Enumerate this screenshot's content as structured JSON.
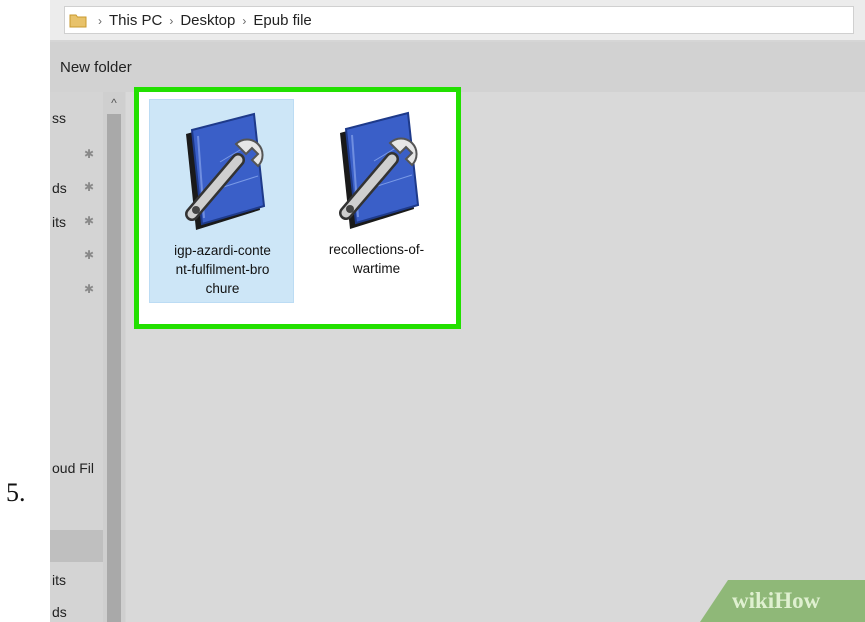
{
  "step_number": "5.",
  "address_bar": {
    "crumbs": [
      "This PC",
      "Desktop",
      "Epub file"
    ],
    "separator": "›"
  },
  "toolbar": {
    "new_folder_label": "New folder"
  },
  "nav_pane": {
    "items": [
      {
        "label": "ss",
        "pinned": false
      },
      {
        "label": "",
        "pinned": true
      },
      {
        "label": "ds",
        "pinned": true
      },
      {
        "label": "its",
        "pinned": true
      },
      {
        "label": "",
        "pinned": true
      },
      {
        "label": "",
        "pinned": true
      },
      {
        "label": "oud Fil",
        "pinned": false
      },
      {
        "label": "its",
        "pinned": false
      },
      {
        "label": "ds",
        "pinned": false
      }
    ],
    "pin_glyph": "✱",
    "scroll_up_glyph": "^"
  },
  "files": [
    {
      "name": "igp-azardi-content-fulfilment-brochure",
      "label_lines": [
        "igp-azardi-conte",
        "nt-fulfilment-bro",
        "chure"
      ],
      "selected": true,
      "icon": "epub-book-wrench-icon"
    },
    {
      "name": "recollections-of-wartime",
      "label_lines": [
        "recollections-of-",
        "wartime"
      ],
      "selected": false,
      "icon": "epub-book-wrench-icon"
    }
  ],
  "watermark": {
    "part1": "wiki",
    "part2": "How"
  },
  "colors": {
    "highlight": "#22e000",
    "selection": "#cde6f7",
    "book_blue": "#3a5fc8",
    "watermark_band": "#8fb878"
  }
}
